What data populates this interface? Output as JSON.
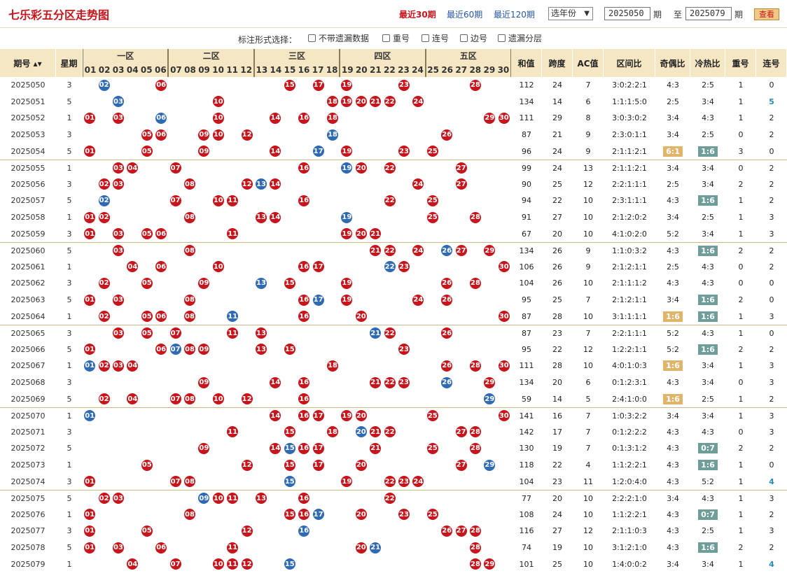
{
  "header": {
    "title": "七乐彩五分区走势图",
    "quick_links": [
      "最近30期",
      "最近60期",
      "最近120期"
    ],
    "active_link": 0,
    "year_select": "选年份",
    "from_period": "2025050",
    "period_unit": "期",
    "to_label": "至",
    "to_period": "2025079",
    "view_button": "查看"
  },
  "options": {
    "label": "标注形式选择：",
    "items": [
      "不带遗漏数据",
      "重号",
      "连号",
      "边号",
      "遗漏分层"
    ]
  },
  "columns": {
    "period": "期号",
    "week": "星期",
    "zones": [
      "一区",
      "二区",
      "三区",
      "四区",
      "五区"
    ],
    "numbers": [
      "01",
      "02",
      "03",
      "04",
      "05",
      "06",
      "07",
      "08",
      "09",
      "10",
      "11",
      "12",
      "13",
      "14",
      "15",
      "16",
      "17",
      "18",
      "19",
      "20",
      "21",
      "22",
      "23",
      "24",
      "25",
      "26",
      "27",
      "28",
      "29",
      "30"
    ],
    "stats": [
      "和值",
      "跨度",
      "AC值",
      "区间比",
      "奇偶比",
      "冷热比",
      "重号",
      "连号"
    ]
  },
  "rows": [
    {
      "p": "2025050",
      "w": "3",
      "b": [
        2,
        6
      ],
      "bb": [
        2
      ],
      "h": [
        15,
        17,
        19,
        23,
        28
      ],
      "s": [
        "112",
        "24",
        "7",
        "3:0:2:2:1",
        "4:3",
        "2:5",
        "1",
        "0"
      ]
    },
    {
      "p": "2025051",
      "w": "5",
      "b": [
        3
      ],
      "bb": [
        3
      ],
      "h": [
        10,
        18,
        19,
        20,
        21,
        22,
        24
      ],
      "s": [
        "134",
        "14",
        "6",
        "1:1:1:5:0",
        "2:5",
        "3:4",
        "1",
        "5"
      ]
    },
    {
      "p": "2025052",
      "w": "1",
      "b": [
        1,
        3,
        6
      ],
      "bb": [
        6
      ],
      "h": [
        10,
        14,
        16,
        18,
        29,
        30
      ],
      "s": [
        "111",
        "29",
        "8",
        "3:0:3:0:2",
        "3:4",
        "4:3",
        "1",
        "2"
      ]
    },
    {
      "p": "2025053",
      "w": "3",
      "b": [
        5,
        6
      ],
      "bb": [
        18
      ],
      "h": [
        9,
        10,
        12,
        18,
        26
      ],
      "s": [
        "87",
        "21",
        "9",
        "2:3:0:1:1",
        "3:4",
        "2:5",
        "0",
        "2"
      ]
    },
    {
      "p": "2025054",
      "w": "5",
      "b": [
        1,
        5
      ],
      "bb": [
        17
      ],
      "h": [
        9,
        14,
        17,
        19,
        23,
        25
      ],
      "s": [
        "96",
        "24",
        "9",
        "2:1:1:2:1",
        "6:1",
        "1:6",
        "3",
        "0"
      ]
    },
    {
      "p": "2025055",
      "w": "1",
      "b": [
        3,
        4
      ],
      "bb": [
        19
      ],
      "h": [
        7,
        16,
        19,
        20,
        22,
        27
      ],
      "s": [
        "99",
        "24",
        "13",
        "2:1:1:2:1",
        "3:4",
        "3:4",
        "0",
        "2"
      ]
    },
    {
      "p": "2025056",
      "w": "3",
      "b": [
        2,
        3
      ],
      "bb": [
        13
      ],
      "h": [
        8,
        12,
        13,
        14,
        24,
        27
      ],
      "s": [
        "90",
        "25",
        "12",
        "2:2:1:1:1",
        "2:5",
        "3:4",
        "2",
        "2"
      ]
    },
    {
      "p": "2025057",
      "w": "5",
      "b": [
        2
      ],
      "bb": [
        2
      ],
      "h": [
        7,
        10,
        11,
        16,
        22,
        25
      ],
      "s": [
        "94",
        "22",
        "10",
        "2:3:1:1:1",
        "4:3",
        "1:6",
        "1",
        "2"
      ]
    },
    {
      "p": "2025058",
      "w": "1",
      "b": [
        1,
        2
      ],
      "bb": [
        19
      ],
      "h": [
        8,
        13,
        14,
        19,
        25,
        28
      ],
      "s": [
        "91",
        "27",
        "10",
        "2:1:2:0:2",
        "3:4",
        "2:5",
        "1",
        "3"
      ]
    },
    {
      "p": "2025059",
      "w": "3",
      "b": [
        1,
        3,
        5,
        6
      ],
      "bb": [],
      "h": [
        11,
        19,
        20,
        21
      ],
      "s": [
        "67",
        "20",
        "10",
        "4:1:0:2:0",
        "5:2",
        "3:4",
        "1",
        "3"
      ]
    },
    {
      "p": "2025060",
      "w": "5",
      "b": [
        3
      ],
      "bb": [
        26
      ],
      "h": [
        8,
        21,
        22,
        24,
        26,
        27,
        29
      ],
      "s": [
        "134",
        "26",
        "9",
        "1:1:0:3:2",
        "4:3",
        "1:6",
        "2",
        "2"
      ]
    },
    {
      "p": "2025061",
      "w": "1",
      "b": [
        4,
        6
      ],
      "bb": [
        22
      ],
      "h": [
        10,
        16,
        17,
        22,
        23,
        30
      ],
      "s": [
        "106",
        "26",
        "9",
        "2:1:2:1:1",
        "2:5",
        "4:3",
        "0",
        "2"
      ]
    },
    {
      "p": "2025062",
      "w": "3",
      "b": [
        2,
        5
      ],
      "bb": [
        13
      ],
      "h": [
        9,
        13,
        15,
        19,
        26,
        28
      ],
      "s": [
        "104",
        "26",
        "10",
        "2:1:1:1:2",
        "4:3",
        "4:3",
        "0",
        "0"
      ]
    },
    {
      "p": "2025063",
      "w": "5",
      "b": [
        1,
        3
      ],
      "bb": [
        17
      ],
      "h": [
        8,
        16,
        17,
        19,
        24,
        26
      ],
      "s": [
        "95",
        "25",
        "7",
        "2:1:2:1:1",
        "3:4",
        "1:6",
        "2",
        "0"
      ]
    },
    {
      "p": "2025064",
      "w": "1",
      "b": [
        2,
        5,
        6
      ],
      "bb": [
        11
      ],
      "h": [
        8,
        11,
        16,
        20,
        30
      ],
      "s": [
        "87",
        "28",
        "10",
        "3:1:1:1:1",
        "1:6",
        "1:6",
        "1",
        "3"
      ]
    },
    {
      "p": "2025065",
      "w": "3",
      "b": [
        3,
        5
      ],
      "bb": [
        21
      ],
      "h": [
        7,
        11,
        13,
        21,
        22,
        26
      ],
      "s": [
        "87",
        "23",
        "7",
        "2:2:1:1:1",
        "5:2",
        "4:3",
        "1",
        "0"
      ]
    },
    {
      "p": "2025066",
      "w": "5",
      "b": [
        1,
        6
      ],
      "bb": [
        7
      ],
      "h": [
        7,
        8,
        9,
        13,
        15,
        23
      ],
      "s": [
        "95",
        "22",
        "12",
        "1:2:2:1:1",
        "5:2",
        "1:6",
        "2",
        "2"
      ]
    },
    {
      "p": "2025067",
      "w": "1",
      "b": [
        1,
        2,
        3,
        4
      ],
      "bb": [
        1
      ],
      "h": [
        18,
        26,
        28,
        30
      ],
      "s": [
        "111",
        "28",
        "10",
        "4:0:1:0:3",
        "1:6",
        "3:4",
        "1",
        "3"
      ]
    },
    {
      "p": "2025068",
      "w": "3",
      "b": [],
      "bb": [
        26
      ],
      "h": [
        9,
        14,
        16,
        21,
        22,
        23,
        26,
        29
      ],
      "s": [
        "134",
        "20",
        "6",
        "0:1:2:3:1",
        "4:3",
        "3:4",
        "0",
        "3"
      ]
    },
    {
      "p": "2025069",
      "w": "5",
      "b": [
        2,
        4,
        7,
        8
      ],
      "bb": [
        29
      ],
      "h": [
        10,
        12,
        16,
        29
      ],
      "s": [
        "59",
        "14",
        "5",
        "2:4:1:0:0",
        "1:6",
        "2:5",
        "1",
        "2"
      ]
    },
    {
      "p": "2025070",
      "w": "1",
      "b": [
        1
      ],
      "bb": [
        1
      ],
      "h": [
        14,
        16,
        17,
        19,
        20,
        25,
        30
      ],
      "s": [
        "141",
        "16",
        "7",
        "1:0:3:2:2",
        "3:4",
        "3:4",
        "1",
        "3"
      ]
    },
    {
      "p": "2025071",
      "w": "3",
      "b": [],
      "bb": [
        20
      ],
      "h": [
        11,
        15,
        18,
        20,
        21,
        22,
        27,
        28
      ],
      "s": [
        "142",
        "17",
        "7",
        "0:1:2:2:2",
        "4:3",
        "4:3",
        "0",
        "3"
      ]
    },
    {
      "p": "2025072",
      "w": "5",
      "b": [],
      "bb": [
        15
      ],
      "h": [
        9,
        14,
        15,
        16,
        17,
        21,
        25,
        28
      ],
      "s": [
        "130",
        "19",
        "7",
        "0:1:3:1:2",
        "4:3",
        "0:7",
        "2",
        "2"
      ]
    },
    {
      "p": "2025073",
      "w": "1",
      "b": [
        5
      ],
      "bb": [
        29
      ],
      "h": [
        12,
        15,
        17,
        20,
        27,
        29
      ],
      "s": [
        "118",
        "22",
        "4",
        "1:1:2:2:1",
        "4:3",
        "1:6",
        "1",
        "0"
      ]
    },
    {
      "p": "2025074",
      "w": "3",
      "b": [
        1,
        7,
        8
      ],
      "bb": [
        15
      ],
      "h": [
        15,
        19,
        22,
        23,
        24
      ],
      "s": [
        "104",
        "23",
        "11",
        "1:2:0:4:0",
        "4:3",
        "5:2",
        "1",
        "4"
      ]
    },
    {
      "p": "2025075",
      "w": "5",
      "b": [
        2,
        3
      ],
      "bb": [
        9
      ],
      "h": [
        9,
        10,
        11,
        13,
        16,
        22
      ],
      "s": [
        "77",
        "20",
        "10",
        "2:2:2:1:0",
        "3:4",
        "4:3",
        "1",
        "3"
      ]
    },
    {
      "p": "2025076",
      "w": "1",
      "b": [
        1,
        8
      ],
      "bb": [
        17
      ],
      "h": [
        15,
        16,
        17,
        20,
        23,
        25
      ],
      "s": [
        "108",
        "24",
        "10",
        "1:1:2:2:1",
        "4:3",
        "0:7",
        "1",
        "2"
      ]
    },
    {
      "p": "2025077",
      "w": "3",
      "b": [
        1,
        5
      ],
      "bb": [
        16
      ],
      "h": [
        12,
        16,
        26,
        27,
        28
      ],
      "s": [
        "116",
        "27",
        "12",
        "2:1:1:0:3",
        "4:3",
        "2:5",
        "1",
        "3"
      ]
    },
    {
      "p": "2025078",
      "w": "5",
      "b": [
        1,
        3,
        6
      ],
      "bb": [
        21
      ],
      "h": [
        11,
        20,
        21,
        28
      ],
      "s": [
        "74",
        "19",
        "10",
        "3:1:2:1:0",
        "4:3",
        "1:6",
        "2",
        "2"
      ]
    },
    {
      "p": "2025079",
      "w": "1",
      "b": [
        4
      ],
      "bb": [
        15
      ],
      "h": [
        7,
        10,
        11,
        12,
        15,
        28,
        29
      ],
      "s": [
        "101",
        "25",
        "10",
        "1:4:0:0:2",
        "3:4",
        "3:4",
        "1",
        "4"
      ]
    }
  ],
  "colors": {
    "red": "#c8141b",
    "blue": "#2f6ab5",
    "header_bg": "#f5e7c4",
    "odd_even_hl": "#e0b56a",
    "cold_hot_hl": "#6f9e9a"
  }
}
